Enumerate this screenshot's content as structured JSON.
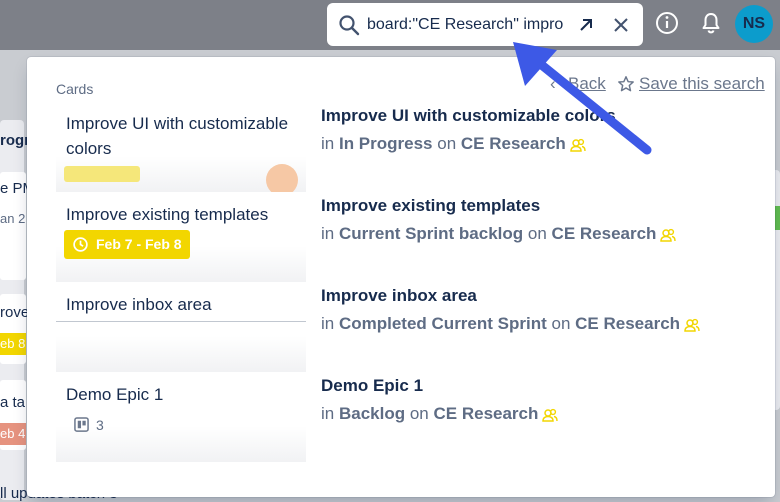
{
  "search": {
    "value": "board:\"CE Research\" improve",
    "open_label": "↗",
    "close_label": "✕"
  },
  "header": {
    "avatar_initials": "NS"
  },
  "colors": {
    "accent": "#0c9ccc",
    "badge_yellow": "#f2d600",
    "arrow_blue": "#3d59e6"
  },
  "panel": {
    "section_label": "Cards",
    "back_label": "Back",
    "save_label": "Save this search"
  },
  "cards": [
    {
      "title_line1": "Improve UI with customizable",
      "title_line2": "colors"
    },
    {
      "title": "Improve existing templates",
      "date_badge": "Feb 7 - Feb 8"
    },
    {
      "title": "Improve inbox area"
    },
    {
      "title": "Demo Epic 1",
      "checklist_count": "3"
    }
  ],
  "results": [
    {
      "title": "Improve UI with customizable colors",
      "in": "in",
      "list": "In Progress",
      "on": "on",
      "board": "CE Research"
    },
    {
      "title": "Improve existing templates",
      "in": "in",
      "list": "Current Sprint backlog",
      "on": "on",
      "board": "CE Research"
    },
    {
      "title": "Improve inbox area",
      "in": "in",
      "list": "Completed Current Sprint",
      "on": "on",
      "board": "CE Research"
    },
    {
      "title": "Demo Epic 1",
      "in": "in",
      "list": "Backlog",
      "on": "on",
      "board": "CE Research"
    }
  ],
  "background": {
    "list_header_fragment": "rogr",
    "card_fragments": [
      "e PM",
      "an 2",
      "rove",
      "eb 8",
      "a ta",
      "eb 4",
      "ll updates batch 3"
    ]
  }
}
